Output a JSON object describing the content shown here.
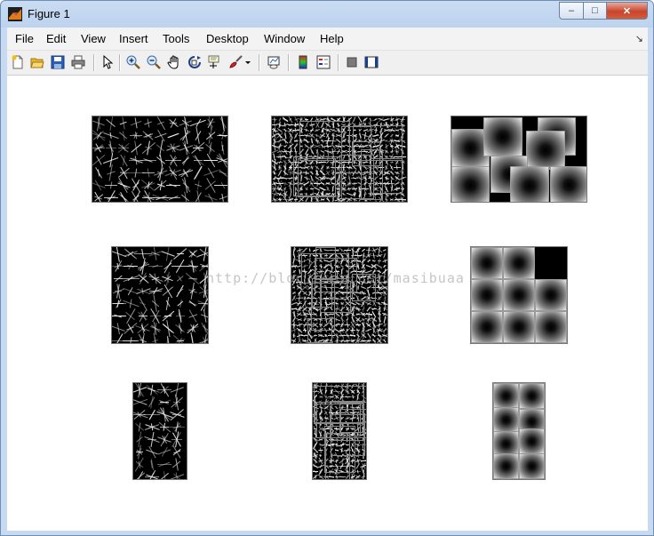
{
  "window": {
    "title": "Figure 1"
  },
  "caption_buttons": {
    "minimize": "–",
    "maximize": "□",
    "close": "✕"
  },
  "menu": [
    "File",
    "Edit",
    "View",
    "Insert",
    "Tools",
    "Desktop",
    "Window",
    "Help"
  ],
  "menu_overflow_icon": "dock-arrow-icon",
  "toolbar": [
    "new-figure-icon",
    "open-file-icon",
    "save-icon",
    "print-icon",
    "select-arrow-icon",
    "zoom-in-icon",
    "zoom-out-icon",
    "pan-hand-icon",
    "rotate-3d-icon",
    "data-cursor-icon",
    "brush-icon",
    "brush-dropdown-icon",
    "link-plot-icon",
    "colorbar-icon",
    "legend-icon",
    "hide-plot-tools-icon",
    "show-plot-tools-icon"
  ],
  "figure": {
    "grid": "3x3 image subplots",
    "rows": [
      [
        "HOG visualization (wide)",
        "HOG block visualization (wide)",
        "Gaussian patches (wide)"
      ],
      [
        "HOG visualization (square)",
        "HOG block visualization (square)",
        "Gaussian patches (square)"
      ],
      [
        "HOG visualization (tall)",
        "HOG block visualization (tall)",
        "Gaussian patches (tall)"
      ]
    ]
  },
  "watermark": "http://blog.csdn.net/masibuaa",
  "colors": {
    "titlebar": "#bcd2ee",
    "close_button": "#c7452d",
    "canvas": "#ffffff",
    "image_bg": "#000000"
  }
}
